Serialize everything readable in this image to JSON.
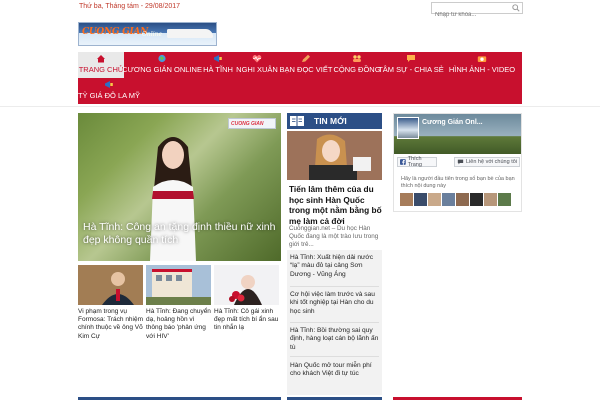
{
  "header": {
    "date": "Thứ ba, Tháng tám - 29/08/2017",
    "search_placeholder": "Nhập từ khóa..."
  },
  "logo": {
    "text": "CUONG GIAN",
    "tagline": "Online"
  },
  "nav": {
    "items": [
      {
        "label": "TRANG CHỦ"
      },
      {
        "label": "CƯƠNG GIÁN ONLINE"
      },
      {
        "label": "HÀ TĨNH"
      },
      {
        "label": "NGHI XUÂN"
      },
      {
        "label": "BẠN ĐỌC VIẾT"
      },
      {
        "label": "CỘNG ĐỒNG"
      },
      {
        "label": "TÂM SỰ - CHIA SẺ"
      },
      {
        "label": "HÌNH ẢNH - VIDEO"
      },
      {
        "label": "TỶ GIÁ ĐÔ LA MỸ"
      }
    ]
  },
  "hero": {
    "badge": "CUONG GIAN",
    "caption": "Hà Tĩnh: Công an tặng định thiều nữ xinh đẹp không quần tích"
  },
  "thumbs": [
    {
      "caption": "Vi phạm trong vụ Formosa: Trách nhiệm chính thuộc về ông Võ Kim Cự"
    },
    {
      "caption": "Hà Tĩnh: Đang chuyển dạ, hoảng hồn vì thông báo 'phản ứng với HIV'"
    },
    {
      "caption": "Hà Tĩnh: Cô gái xinh đẹp mất tích bí ẩn sau tin nhắn lạ"
    }
  ],
  "middle": {
    "heading": "TIN MỚI",
    "featured_title": "Tiến lâm thêm của du học sinh Hàn Quốc trong một nằm bằng bố mẹ làm cả đời",
    "featured_summary": "Cuonggian.net – Du học Hàn Quốc đang là một trào lưu trong giới trẻ...",
    "list": [
      {
        "text": "Hà Tĩnh: Xuất hiện dải nước “lạ” màu đỏ tại cảng Sơn Dương - Vũng Áng"
      },
      {
        "text": "Cơ hội việc làm trước và sau khi tốt nghiệp tại Hàn cho du học sinh"
      },
      {
        "text": "Hà Tĩnh: Bồi thường sai quy định, hàng loạt cán bộ lãnh ấn tù"
      },
      {
        "text": "Hàn Quốc mở tour miễn phí cho khách Việt đi tự túc"
      }
    ]
  },
  "fb_widget": {
    "page_name": "Cương Gián Onl...",
    "like_label": "Thích Trang",
    "share_label": "Liên hệ với chúng tôi",
    "invite_text": "Hãy là người đầu tiên trong số bạn bè của bạn thích nội dung này"
  },
  "colors": {
    "accent_red": "#c8102e",
    "header_blue": "#2c4f86"
  }
}
